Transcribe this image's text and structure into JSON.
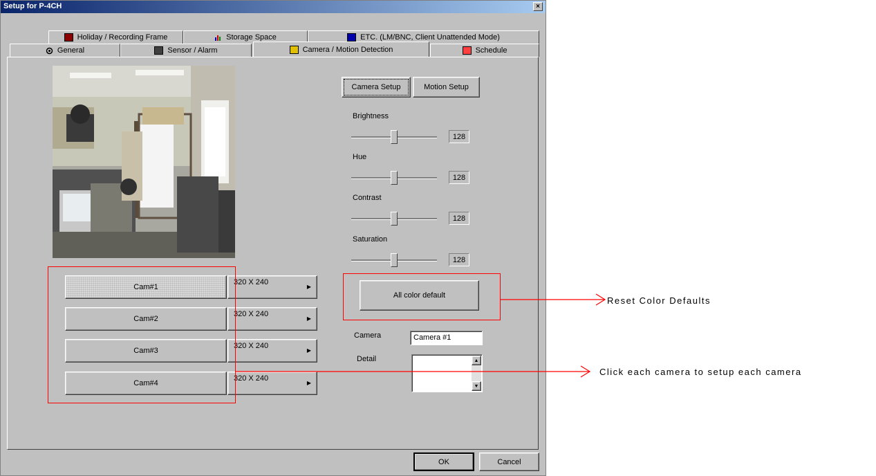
{
  "window": {
    "title": "Setup for P-4CH",
    "close_glyph": "×"
  },
  "tabs_row1": [
    {
      "label": "Holiday / Recording Frame",
      "icon": "calendar-icon",
      "color": "#8b0000"
    },
    {
      "label": "Storage Space",
      "icon": "storage-chart-icon",
      "color": "#0000aa"
    },
    {
      "label": "ETC. (LM/BNC, Client Unattended Mode)",
      "icon": "monitor-icon",
      "color": "#000080"
    }
  ],
  "tabs_row2": [
    {
      "label": "General",
      "icon": "gear-icon"
    },
    {
      "label": "Sensor / Alarm",
      "icon": "sensor-icon"
    },
    {
      "label": "Camera / Motion Detection",
      "icon": "camera-icon",
      "active": true
    },
    {
      "label": "Schedule",
      "icon": "schedule-icon"
    }
  ],
  "setup_tabs": {
    "camera_setup": "Camera Setup",
    "motion_setup": "Motion Setup"
  },
  "sliders": [
    {
      "label": "Brightness",
      "value": "128",
      "level": 0.5
    },
    {
      "label": "Hue",
      "value": "128",
      "level": 0.5
    },
    {
      "label": "Contrast",
      "value": "128",
      "level": 0.5
    },
    {
      "label": "Saturation",
      "value": "128",
      "level": 0.5
    }
  ],
  "all_color_default": "All color default",
  "cameras": [
    {
      "label": "Cam#1",
      "resolution": "320 X 240",
      "selected": true
    },
    {
      "label": "Cam#2",
      "resolution": "320 X 240"
    },
    {
      "label": "Cam#3",
      "resolution": "320 X 240"
    },
    {
      "label": "Cam#4",
      "resolution": "320 X 240"
    }
  ],
  "camera_field": {
    "label": "Camera",
    "value": "Camera #1"
  },
  "detail_field": {
    "label": "Detail",
    "value": ""
  },
  "footer": {
    "ok": "OK",
    "cancel": "Cancel"
  },
  "annotations": {
    "reset_colors": "Reset Color Defaults",
    "click_camera": "Click each camera to setup each camera"
  },
  "colors": {
    "annotation": "#ff0000",
    "titlebar": "#0a246a"
  }
}
